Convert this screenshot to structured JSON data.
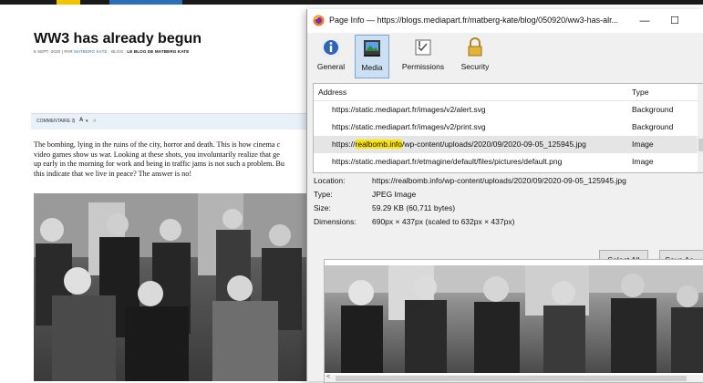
{
  "webpage": {
    "title": "WW3 has already begun",
    "byline_date": "5 SEPT. 2020",
    "byline_by": "PAR",
    "byline_author": "MATBERG KATE",
    "byline_blog_label": "BLOG :",
    "byline_blog": "LE BLOG DE MATBERG KATE",
    "comment_label": "COMMENTAIRE 2",
    "font_control": "A",
    "article_lines": [
      "The bombing, lying in the ruins of the city, horror and death. This is how cinema c",
      "video games show us war. Looking at these shots, you involuntarily realize that ge",
      "up early in the morning for work and being in traffic jams is not such a problem. Bu",
      "this indicate that we live in peace? The answer is no!"
    ]
  },
  "dialog": {
    "title": "Page Info — https://blogs.mediapart.fr/matberg-kate/blog/050920/ww3-has-alr...",
    "minimize": "—",
    "maximize": "☐",
    "close": "✕",
    "tabs": [
      {
        "label": "General",
        "icon": "info-icon"
      },
      {
        "label": "Media",
        "icon": "media-icon"
      },
      {
        "label": "Permissions",
        "icon": "permissions-icon"
      },
      {
        "label": "Security",
        "icon": "lock-icon"
      }
    ],
    "active_tab": "Media",
    "columns": {
      "address": "Address",
      "type": "Type"
    },
    "rows": [
      {
        "addr": "https://static.mediapart.fr/images/v2/alert.svg",
        "type": "Background"
      },
      {
        "addr": "https://static.mediapart.fr/images/v2/print.svg",
        "type": "Background"
      },
      {
        "addr_prefix": "https://",
        "addr_highlight": "realbomb.info",
        "addr_suffix": "/wp-content/uploads/2020/09/2020-09-05_125945.jpg",
        "type": "Image"
      },
      {
        "addr": "https://static.mediapart.fr/etmagine/default/files/pictures/default.png",
        "type": "Image"
      }
    ],
    "details": {
      "location_label": "Location:",
      "location": "https://realbomb.info/wp-content/uploads/2020/09/2020-09-05_125945.jpg",
      "type_label": "Type:",
      "type": "JPEG Image",
      "size_label": "Size:",
      "size": "59.29 KB (60,711 bytes)",
      "dimensions_label": "Dimensions:",
      "dimensions": "690px × 437px (scaled to 632px × 437px)"
    },
    "select_all": "Select All",
    "save_as": "Save As..."
  },
  "colors": {
    "highlight": "#ffe600",
    "active_tab_bg": "#cde0f3",
    "accent_link": "#2b6db8"
  }
}
